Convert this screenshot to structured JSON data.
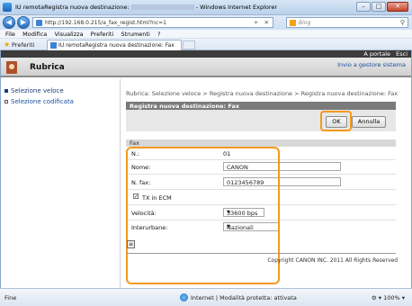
{
  "window": {
    "title": "IU remotaRegistra nuova destinazione: ",
    "title_suffix": "- Windows Internet Explorer",
    "min": "–",
    "max": "□",
    "close": "✕"
  },
  "address_bar": {
    "url": "http://192.168.0.215/a_fax_regist.html?nc=1",
    "icons": "+ ✕"
  },
  "search": {
    "placeholder": "Bing",
    "icon": "magnifier-icon"
  },
  "menu": [
    "File",
    "Modifica",
    "Visualizza",
    "Preferiti",
    "Strumenti",
    "?"
  ],
  "favorites": {
    "label": "Preferiti",
    "tab_title": "IU remotaRegistra nuova destinazione: Fax"
  },
  "site": {
    "portal_link": "A portale",
    "exit_link": "Esci",
    "app_title": "Rubrica",
    "admin_link": "Invio a gestore sistema"
  },
  "sidebar": {
    "items": [
      {
        "label": "Selezione veloce",
        "active": true
      },
      {
        "label": "Selezione codificata",
        "active": false
      }
    ]
  },
  "breadcrumb": "Rubrica: Selezione veloce > Registra nuova destinazione > Registra nuova destinazione: Fax",
  "panel": {
    "title": "Registra nuova destinazione: Fax",
    "ok": "OK",
    "cancel": "Annulla"
  },
  "form": {
    "section": "Fax",
    "n_label": "N.:",
    "n_value": "01",
    "name_label": "Nome:",
    "name_value": "CANON",
    "fax_label": "N. fax:",
    "fax_value": "0123456789",
    "ecm_label": "TX in ECM",
    "ecm_checked": true,
    "speed_label": "Velocità:",
    "speed_value": "33600 bps",
    "interurban_label": "Interurbane:",
    "interurban_value": "Nazionali"
  },
  "footer": {
    "copyright": "Copyright CANON INC. 2011 All Rights Reserved"
  },
  "statusbar": {
    "left": "Fine",
    "zone": "Internet | Modalità protetta: attivata",
    "zoom": "100%"
  },
  "colors": {
    "highlight": "#f39a1c",
    "panel_header": "#7a7a7a",
    "link": "#1c4fa0"
  }
}
